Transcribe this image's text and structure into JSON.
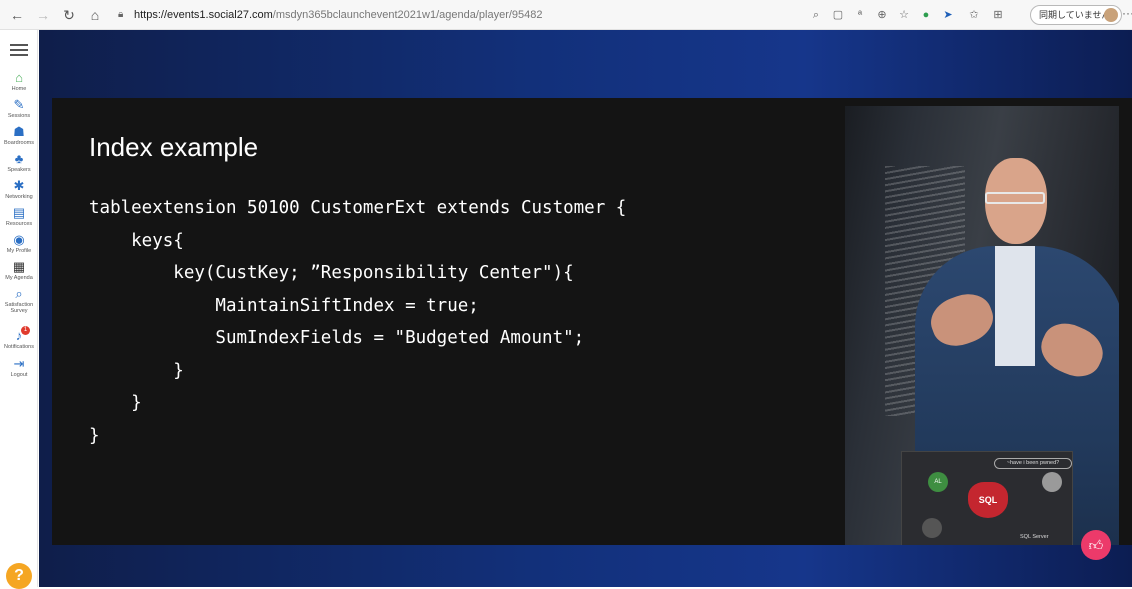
{
  "browser": {
    "url_host": "https://events1.social27.com",
    "url_path": "/msdyn365bclaunchevent2021w1/agenda/player/95482",
    "sync_label": "同期していません",
    "icons": [
      "back-icon",
      "forward-icon",
      "refresh-icon",
      "home-icon",
      "lock-icon"
    ]
  },
  "sidebar": {
    "items": [
      {
        "label": "Home",
        "icon": "home-icon"
      },
      {
        "label": "Sessions",
        "icon": "pen-icon"
      },
      {
        "label": "Boardrooms",
        "icon": "people-icon"
      },
      {
        "label": "Speakers",
        "icon": "speaker-icon"
      },
      {
        "label": "Networking",
        "icon": "network-icon"
      },
      {
        "label": "Resources",
        "icon": "book-icon"
      },
      {
        "label": "My Profile",
        "icon": "profile-icon"
      },
      {
        "label": "My Agenda",
        "icon": "calendar-icon"
      },
      {
        "label": "Satisfaction Survey",
        "icon": "survey-icon"
      },
      {
        "label": "Notifications",
        "icon": "bell-icon"
      },
      {
        "label": "Logout",
        "icon": "logout-icon"
      }
    ],
    "notification_count": "1",
    "help_label": "?"
  },
  "slide": {
    "title": "Index example",
    "code": "tableextension 50100 CustomerExt extends Customer {\n    keys{\n        key(CustKey; ”Responsibility Center\"){\n            MaintainSiftIndex = true;\n            SumIndexFields = \"Budgeted Amount\";\n        }\n    }\n}"
  },
  "video": {
    "laptop_heart_text": "SQL",
    "laptop_bubble_text": "~have i been pwned?",
    "laptop_sticker_text": "SQL Server"
  },
  "colors": {
    "stage_blue": "#12307a",
    "slide_bg": "#141414",
    "like_button": "#ec3a6a",
    "help_button": "#f5a623"
  }
}
